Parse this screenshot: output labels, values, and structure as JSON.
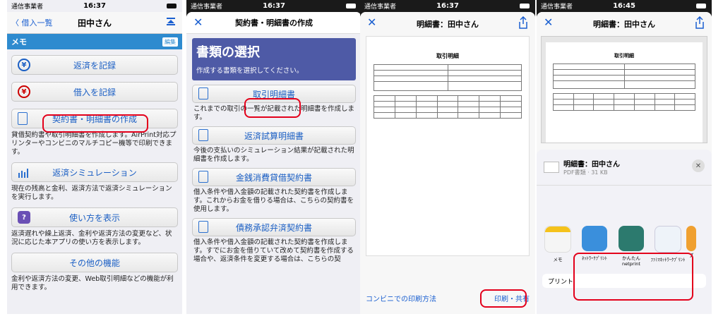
{
  "status": {
    "carrier": "通信事業者",
    "time1": "16:37",
    "time2": "16:37",
    "time3": "16:37",
    "time4": "16:45"
  },
  "phone1": {
    "back": "〈 借入一覧",
    "title": "田中さん",
    "memo": "メモ",
    "edit": "編集",
    "buttons": [
      {
        "label": "返済を記録",
        "icon": "¥"
      },
      {
        "label": "借入を記録",
        "icon": "¥"
      },
      {
        "label": "契約書・明細書の作成",
        "desc": "貸借契約書や取引明細書を作成します。AirPrint対応プリンターやコンビニのマルチコピー機等で印刷できます。"
      },
      {
        "label": "返済シミュレーション",
        "desc": "現在の残高と金利、返済方法で返済シミュレーションを実行します。"
      },
      {
        "label": "使い方を表示",
        "icon": "?",
        "desc": "返済遅れや繰上返済、金利や返済方法の変更など、状況に応じた本アプリの使い方を表示します。"
      },
      {
        "label": "その他の機能",
        "desc": "金利や返済方法の変更、Web取引明細などの機能が利用できます。"
      }
    ]
  },
  "phone2": {
    "close": "✕",
    "title": "契約書・明細書の作成",
    "banner_title": "書類の選択",
    "banner_sub": "作成する書類を選択してください。",
    "options": [
      {
        "label": "取引明細書",
        "desc": "これまでの取引の一覧が記載された明細書を作成します。"
      },
      {
        "label": "返済試算明細書",
        "desc": "今後の支払いのシミュレーション結果が記載された明細書を作成します。"
      },
      {
        "label": "金銭消費貸借契約書",
        "desc": "借入条件や借入金額の記載された契約書を作成します。これからお金を借りる場合は、こちらの契約書を使用します。"
      },
      {
        "label": "債務承認弁済契約書",
        "desc": "借入条件や借入金額の記載された契約書を作成します。すでにお金を借りていて改めて契約書を作成する場合や、返済条件を変更する場合は、こちらの契"
      }
    ]
  },
  "phone3": {
    "close": "✕",
    "title": "明細書：田中さん",
    "doc_title": "取引明細",
    "convenience": "コンビニでの印刷方法",
    "print_share": "印刷・共有"
  },
  "phone4": {
    "close": "✕",
    "title": "明細書：田中さん",
    "doc_title": "取引明細",
    "file_name": "明細書：田中さん",
    "file_meta": "PDF書類 · 31 KB",
    "apps": [
      {
        "label": "メモ",
        "color": "#f5f5f5"
      },
      {
        "label": "ﾈｯﾄﾜｰｸﾌﾟﾘﾝﾄ",
        "color": "#3a8fdc"
      },
      {
        "label": "かんたん netprint",
        "color": "#2c7a6e"
      },
      {
        "label": "ﾌｧﾐﾏﾈｯﾄﾜｰｸﾌﾟﾘﾝﾄ",
        "color": "#eef3f9"
      },
      {
        "label": "プ",
        "color": "#f0a030"
      }
    ],
    "print_row": "プリント"
  },
  "colors": {
    "ring": "#e3001b",
    "link": "#1b5fc4",
    "banner": "#4e5aa6",
    "memo": "#2e8bcf"
  }
}
